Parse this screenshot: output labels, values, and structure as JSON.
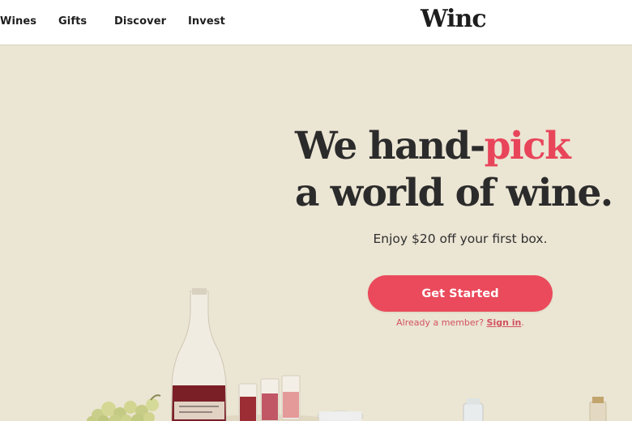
{
  "nav": {
    "items": [
      {
        "label": "Wines"
      },
      {
        "label": "Gifts"
      },
      {
        "label": "Discover"
      },
      {
        "label": "Invest"
      }
    ],
    "logo": "Winc"
  },
  "hero": {
    "headline_part1": "We hand",
    "headline_dash": "-",
    "headline_accent": "pick",
    "headline_line2": "a world of wine.",
    "offer": "Enjoy $20 off your first box.",
    "cta_label": "Get Started",
    "member_prompt": "Already a member?",
    "signin_label": "Sign in",
    "member_suffix": "."
  },
  "colors": {
    "background": "#ebe5d3",
    "accent": "#e8455a",
    "headline": "#2b2b2b",
    "nav_bg": "#ffffff"
  }
}
